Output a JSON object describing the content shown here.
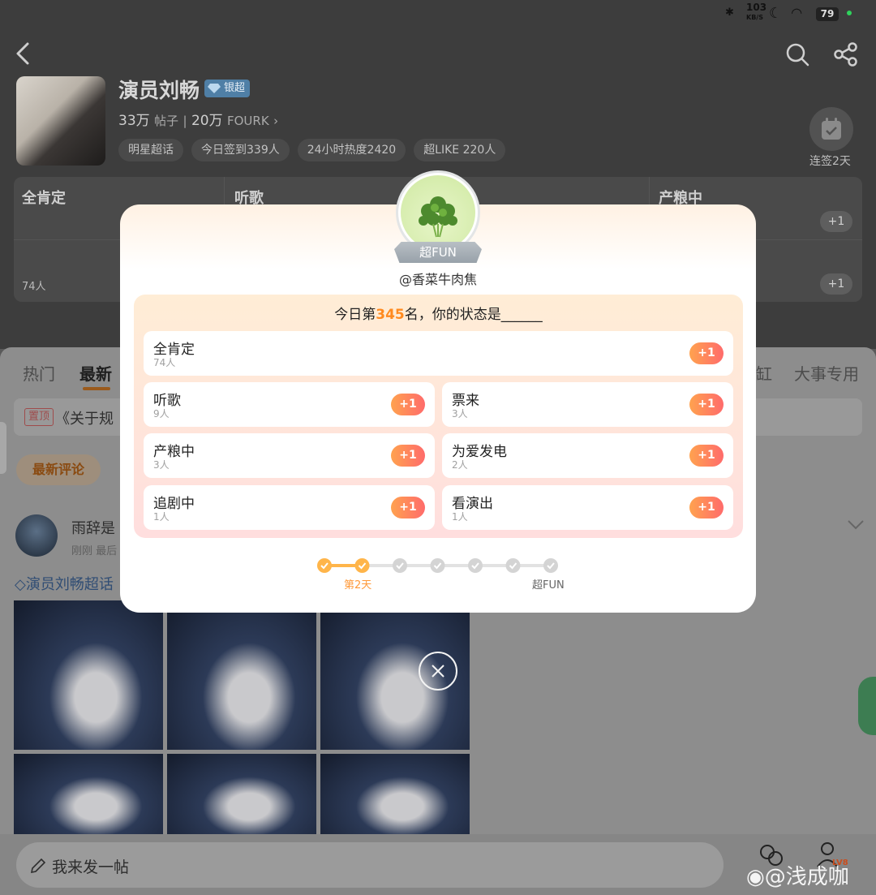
{
  "status_bar": {
    "network_speed": "103",
    "network_unit": "KB/S",
    "battery": "79"
  },
  "header": {
    "title": "演员刘畅",
    "badge": "银超",
    "posts_count": "33万",
    "posts_label": "帖子",
    "fans_count": "20万",
    "fans_label": "FOURK",
    "tags": [
      "明星超话",
      "今日签到339人",
      "24小时热度2420",
      "超LIKE 220人"
    ],
    "checkin_label": "连签2天"
  },
  "background_grid": {
    "cells": [
      "全肯定",
      "听歌",
      "产粮中"
    ],
    "plus_label": "+1",
    "count": "74人"
  },
  "feed": {
    "tabs": [
      "热门",
      "最新",
      "缸",
      "大事专用"
    ],
    "active_tab": "最新",
    "pinned_tag": "置顶",
    "pinned_text": "《关于规",
    "latest_button": "最新评论",
    "post": {
      "author": "雨辞是",
      "meta": "刚刚 最后",
      "topic": "演员刘畅超话"
    },
    "compose_placeholder": "我来发一帖"
  },
  "modal": {
    "medal_label": "超FUN",
    "user_handle": "@香菜牛肉焦",
    "question_prefix": "今日第",
    "question_rank": "345",
    "question_suffix": "名，你的状态是______",
    "options": [
      {
        "label": "全肯定",
        "count": "74人"
      },
      {
        "label": "听歌",
        "count": "9人"
      },
      {
        "label": "票来",
        "count": "3人"
      },
      {
        "label": "产粮中",
        "count": "3人"
      },
      {
        "label": "为爱发电",
        "count": "2人"
      },
      {
        "label": "追剧中",
        "count": "1人"
      },
      {
        "label": "看演出",
        "count": "1人"
      }
    ],
    "plus_label": "+1",
    "progress": {
      "current_day": 2,
      "total_steps": 7,
      "current_label": "第2天",
      "end_label": "超FUN"
    }
  },
  "watermark": "@浅成咖",
  "colors": {
    "accent_orange": "#ff8a1f",
    "button_gradient_start": "#ffa24f",
    "button_gradient_end": "#ff6b6b",
    "overlay": "#5a5a5a"
  }
}
